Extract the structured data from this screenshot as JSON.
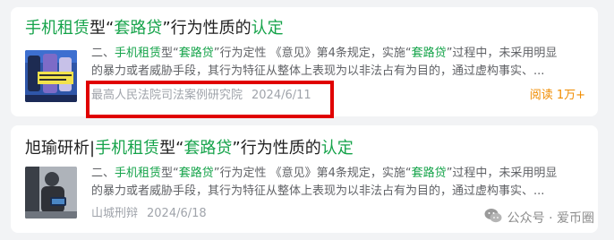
{
  "results": [
    {
      "title": {
        "hl1": "手机租赁",
        "t1": "型“",
        "hl2": "套路贷",
        "t2": "”行为性质的",
        "hl3": "认定"
      },
      "snippet": {
        "line1": {
          "p1": "二、",
          "hl1": "手机租赁",
          "p2": "型“",
          "hl2": "套路贷",
          "p3": "”行为定性 《意见》第4条规定，实施“",
          "hl3": "套路贷",
          "p4": "”过程中，未采用明显"
        },
        "line2": "的暴力或者威胁手段，其行为特征从整体上表现为以非法占有为目的，通过虚构事实、..."
      },
      "source": "最高人民法院司法案例研究院",
      "date": "2024/6/11",
      "reads": "阅读 1万+",
      "thumb_icon": "phone-promo-thumbnail"
    },
    {
      "title": {
        "pre": "旭瑜研析|",
        "hl1": "手机租赁",
        "t1": "型“",
        "hl2": "套路贷",
        "t2": "”行为性质的",
        "hl3": "认定"
      },
      "snippet": {
        "line1": {
          "p1": "二、",
          "hl1": "手机租赁",
          "p2": "型“",
          "hl2": "套路贷",
          "p3": "”行为定性 《意见》第4条规定，实施“",
          "hl3": "套路贷",
          "p4": "”过程中，未采用明显"
        },
        "line2": "的暴力或者威胁手段，其行为特征从整体上表现为以非法占有为目的，通过虚构事实、..."
      },
      "source": "山城刑辩",
      "date": "2024/6/18",
      "thumb_icon": "person-phone-thumbnail"
    }
  ],
  "watermark": {
    "icon": "wechat-icon",
    "text": "公众号 · 爱币圈"
  },
  "colors": {
    "highlight": "#15a34a",
    "reads": "#f08c00",
    "annotation_box": "#e00000"
  }
}
